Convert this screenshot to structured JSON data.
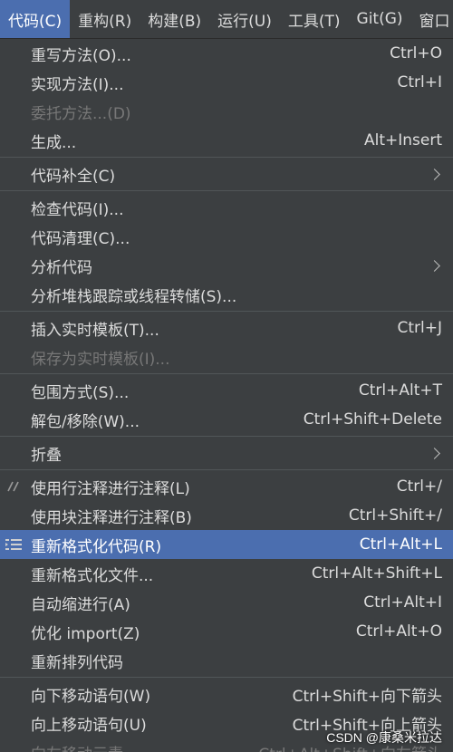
{
  "menubar": {
    "items": [
      "代码(C)",
      "重构(R)",
      "构建(B)",
      "运行(U)",
      "工具(T)",
      "Git(G)",
      "窗口"
    ]
  },
  "menu": {
    "groups": [
      [
        {
          "label": "重写方法(O)...",
          "shortcut": "Ctrl+O"
        },
        {
          "label": "实现方法(I)...",
          "shortcut": "Ctrl+I"
        },
        {
          "label": "委托方法...(D)",
          "shortcut": "",
          "disabled": true
        },
        {
          "label": "生成...",
          "shortcut": "Alt+Insert"
        }
      ],
      [
        {
          "label": "代码补全(C)",
          "submenu": true
        }
      ],
      [
        {
          "label": "检查代码(I)..."
        },
        {
          "label": "代码清理(C)..."
        },
        {
          "label": "分析代码",
          "submenu": true
        },
        {
          "label": "分析堆栈跟踪或线程转储(S)..."
        }
      ],
      [
        {
          "label": "插入实时模板(T)...",
          "shortcut": "Ctrl+J"
        },
        {
          "label": "保存为实时模板(I)...",
          "disabled": true
        }
      ],
      [
        {
          "label": "包围方式(S)...",
          "shortcut": "Ctrl+Alt+T"
        },
        {
          "label": "解包/移除(W)...",
          "shortcut": "Ctrl+Shift+Delete"
        }
      ],
      [
        {
          "label": "折叠",
          "submenu": true
        }
      ],
      [
        {
          "label": "使用行注释进行注释(L)",
          "shortcut": "Ctrl+/",
          "icon": "line-comment-icon"
        },
        {
          "label": "使用块注释进行注释(B)",
          "shortcut": "Ctrl+Shift+/"
        },
        {
          "label": "重新格式化代码(R)",
          "shortcut": "Ctrl+Alt+L",
          "icon": "reformat-code-icon",
          "selected": true
        },
        {
          "label": "重新格式化文件...",
          "shortcut": "Ctrl+Alt+Shift+L"
        },
        {
          "label": "自动缩进行(A)",
          "shortcut": "Ctrl+Alt+I"
        },
        {
          "label": "优化 import(Z)",
          "shortcut": "Ctrl+Alt+O"
        },
        {
          "label": "重新排列代码"
        }
      ],
      [
        {
          "label": "向下移动语句(W)",
          "shortcut": "Ctrl+Shift+向下箭头"
        },
        {
          "label": "向上移动语句(U)",
          "shortcut": "Ctrl+Shift+向上箭头"
        },
        {
          "label": "向左移动元素",
          "shortcut": "Ctrl+Alt+Shift+向左箭头",
          "disabled": true
        }
      ]
    ]
  },
  "watermark": "CSDN @康桑米拉达"
}
